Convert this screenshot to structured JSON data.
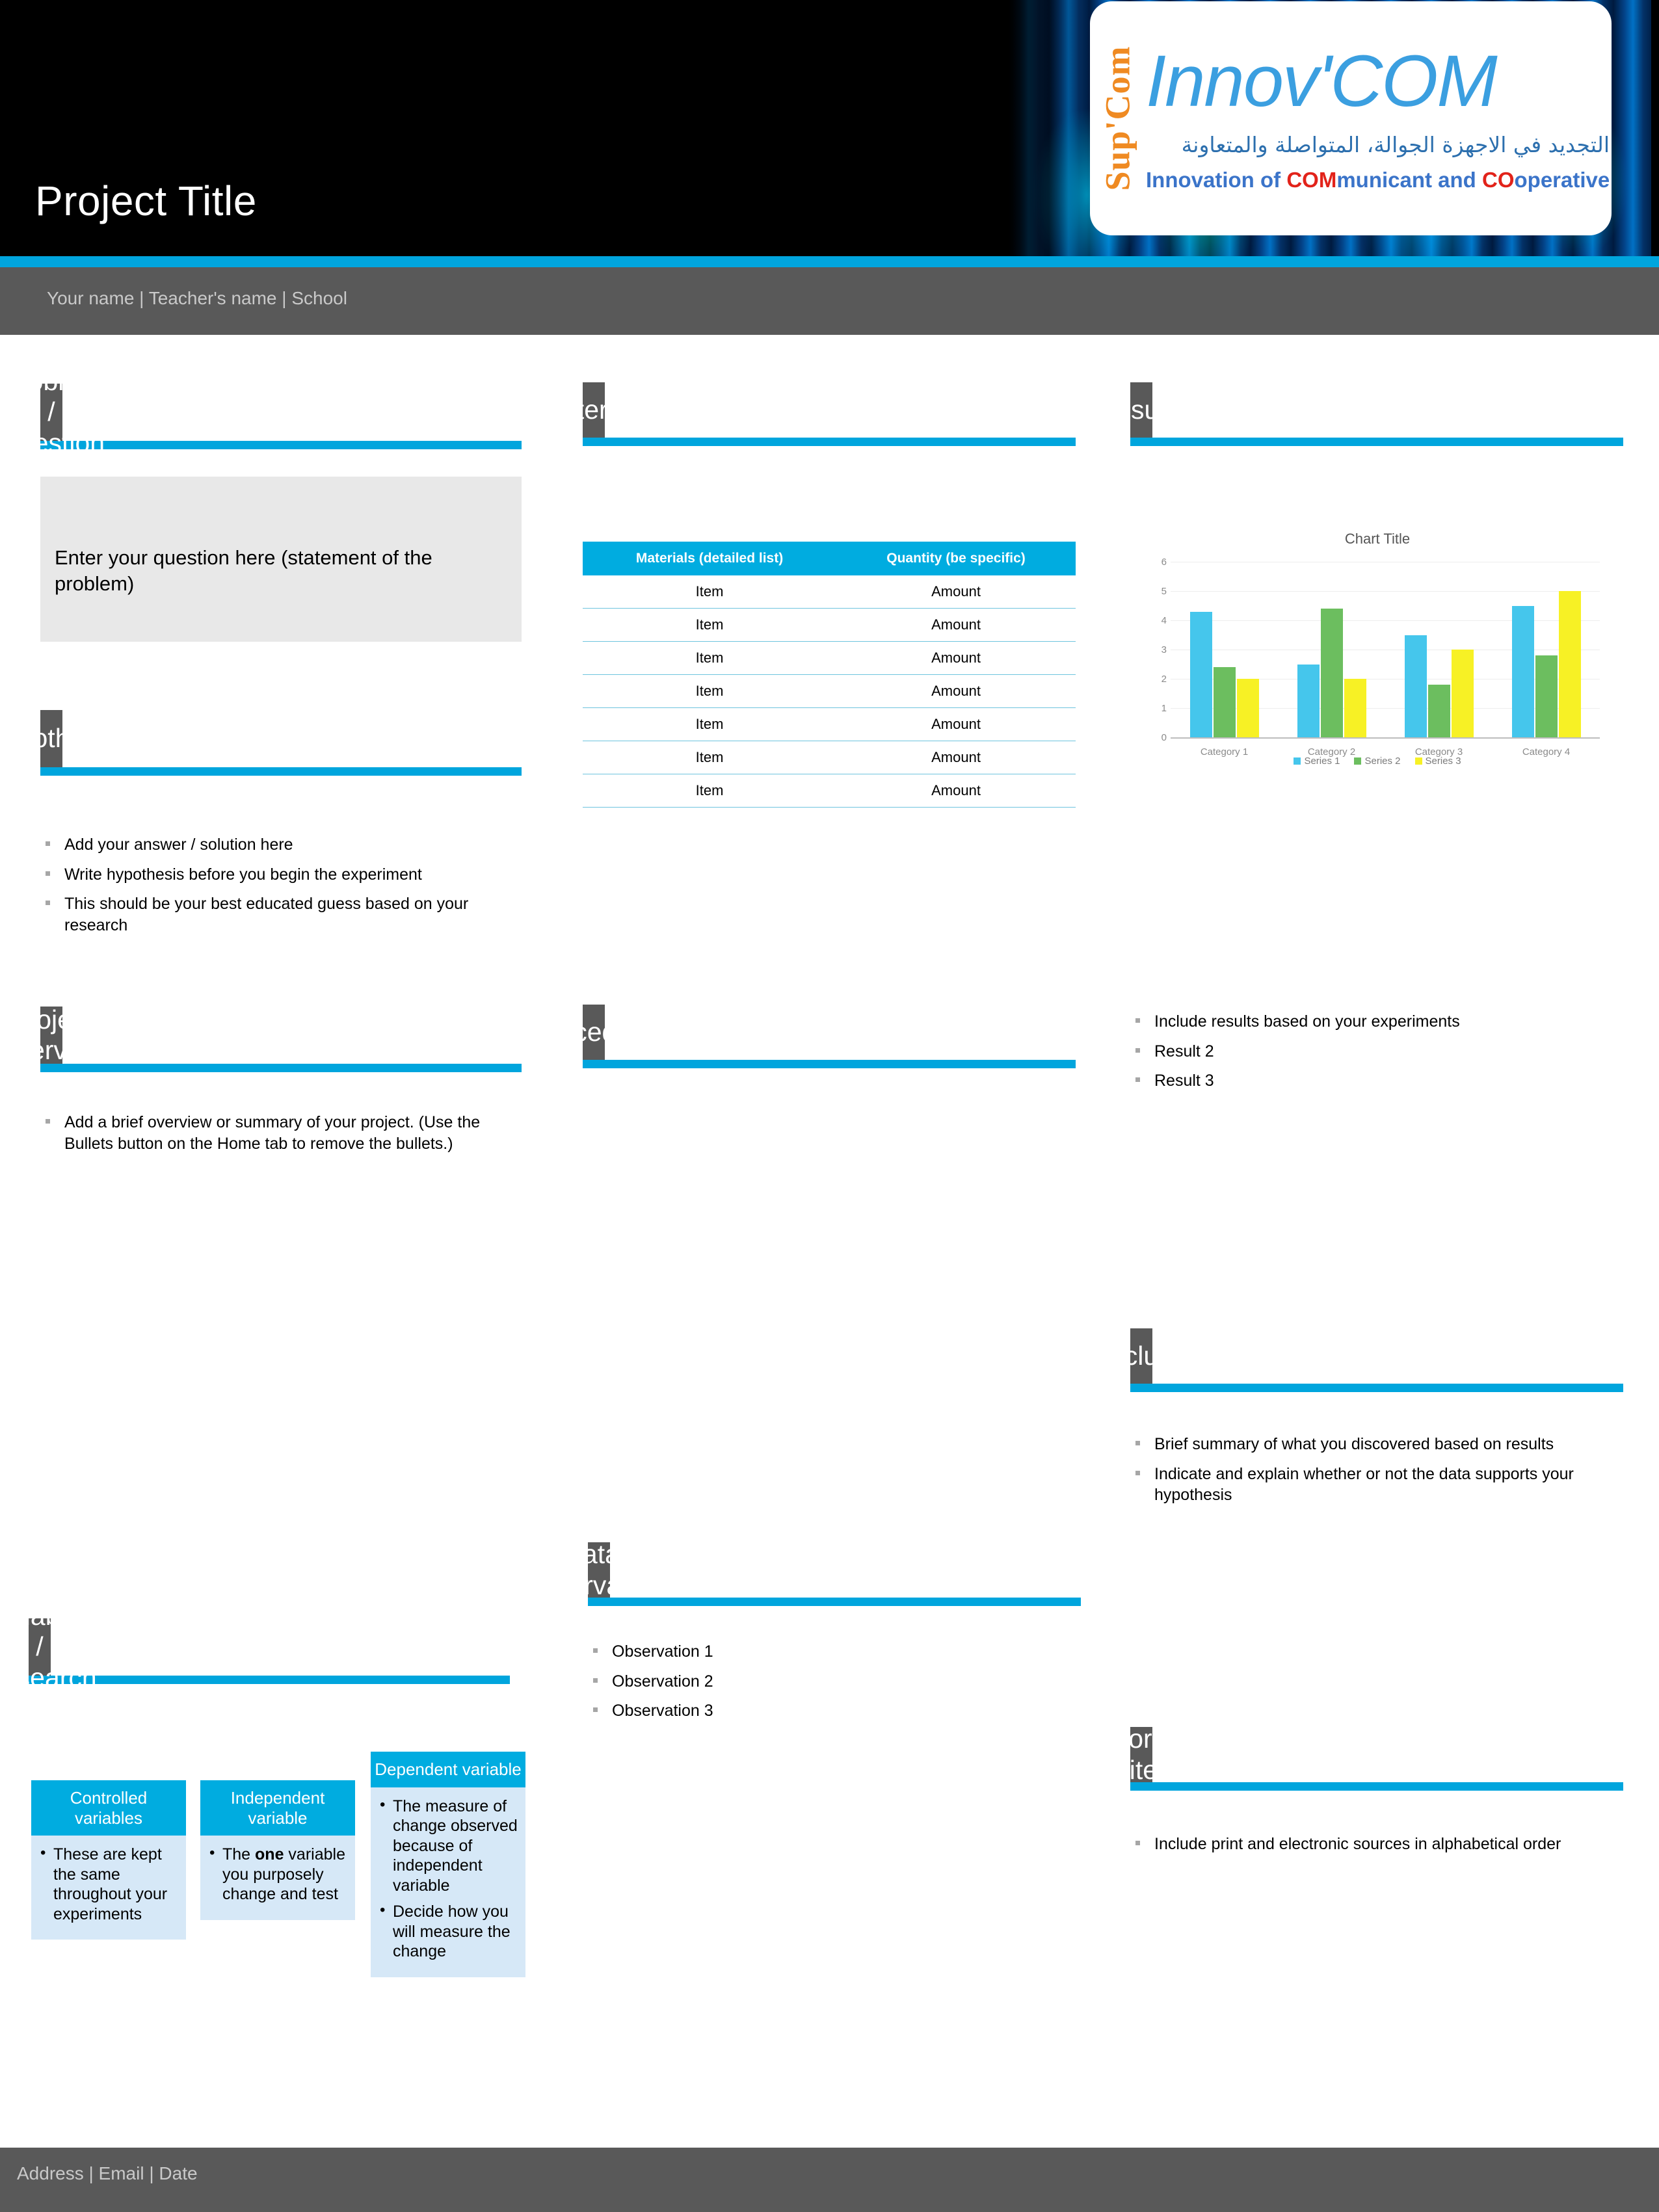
{
  "banner": {
    "title": "Project Title",
    "byline": "Your name | Teacher's name | School",
    "accent_color": "#00a5dd",
    "header_gray": "#595959"
  },
  "logo": {
    "vertical_text": "Sup'Com",
    "main_text": "Innov'COM",
    "arabic_text": "مخبر التجديد في الاجهزة الجوالة، المتواصلة والمتعاونة",
    "tagline_pre": "Innovation of ",
    "tagline_com": "COM",
    "tagline_mid": "municant and ",
    "tagline_co": "CO",
    "tagline_post": "operative Mobiles",
    "orange": "#ef8a22",
    "blue": "#3b9fe0",
    "red": "#e2231a"
  },
  "sections": {
    "problem": {
      "title": "Problem / Question",
      "body": "Enter your question here (statement of the problem)"
    },
    "hypothesis": {
      "title": "Hypothesis",
      "bullets": [
        "Add your answer / solution here",
        "Write hypothesis before you begin the experiment",
        "This should be your best educated guess based on your research"
      ]
    },
    "project_overview": {
      "title": "Project Overview",
      "bullets": [
        "Add a brief overview or summary of your project. (Use the Bullets button on the Home tab to remove the bullets.)"
      ]
    },
    "variables": {
      "title": "Variables / Research",
      "cards": [
        {
          "heading": "Controlled variables",
          "bullets": [
            {
              "pre": "These are kept the same throughout your experiments",
              "bold": "",
              "post": ""
            }
          ]
        },
        {
          "heading": "Independent variable",
          "bullets": [
            {
              "pre": "The ",
              "bold": "one",
              "post": " variable you purposely change and test"
            }
          ]
        },
        {
          "heading": "Dependent variable",
          "bullets": [
            {
              "pre": "The measure of change observed because of independent variable",
              "bold": "",
              "post": ""
            },
            {
              "pre": "Decide how you will measure the change",
              "bold": "",
              "post": ""
            }
          ]
        }
      ]
    },
    "materials": {
      "title": "Materials",
      "table": {
        "headers": [
          "Materials (detailed list)",
          "Quantity (be specific)"
        ],
        "rows": [
          [
            "Item",
            "Amount"
          ],
          [
            "Item",
            "Amount"
          ],
          [
            "Item",
            "Amount"
          ],
          [
            "Item",
            "Amount"
          ],
          [
            "Item",
            "Amount"
          ],
          [
            "Item",
            "Amount"
          ],
          [
            "Item",
            "Amount"
          ]
        ]
      }
    },
    "procedure": {
      "title": "Procedure"
    },
    "data_observations": {
      "title": "Data / Observations",
      "bullets": [
        "Observation 1",
        "Observation 2",
        "Observation 3"
      ]
    },
    "results": {
      "title": "Results",
      "bullets": [
        "Include results based on your experiments",
        "Result 2",
        "Result 3"
      ]
    },
    "conclusion": {
      "title": "Conclusion",
      "bullets": [
        "Brief summary of what you discovered based on results",
        "Indicate and explain whether or not the data supports your hypothesis"
      ]
    },
    "works_cited": {
      "title": "Works Cited",
      "bullets": [
        "Include print and electronic sources in alphabetical order"
      ]
    }
  },
  "footer": {
    "text": "Address | Email | Date"
  },
  "chart_data": {
    "type": "bar",
    "title": "Chart Title",
    "xlabel": "",
    "ylabel": "",
    "ylim": [
      0,
      6
    ],
    "yticks": [
      0,
      1,
      2,
      3,
      4,
      5,
      6
    ],
    "grid": true,
    "legend_position": "bottom",
    "categories": [
      "Category 1",
      "Category 2",
      "Category 3",
      "Category 4"
    ],
    "series": [
      {
        "name": "Series 1",
        "color": "#45c6ec",
        "values": [
          4.3,
          2.5,
          3.5,
          4.5
        ]
      },
      {
        "name": "Series 2",
        "color": "#6cbe5f",
        "values": [
          2.4,
          4.4,
          1.8,
          2.8
        ]
      },
      {
        "name": "Series 3",
        "color": "#f7f125",
        "values": [
          2,
          2,
          3,
          5
        ]
      }
    ]
  }
}
